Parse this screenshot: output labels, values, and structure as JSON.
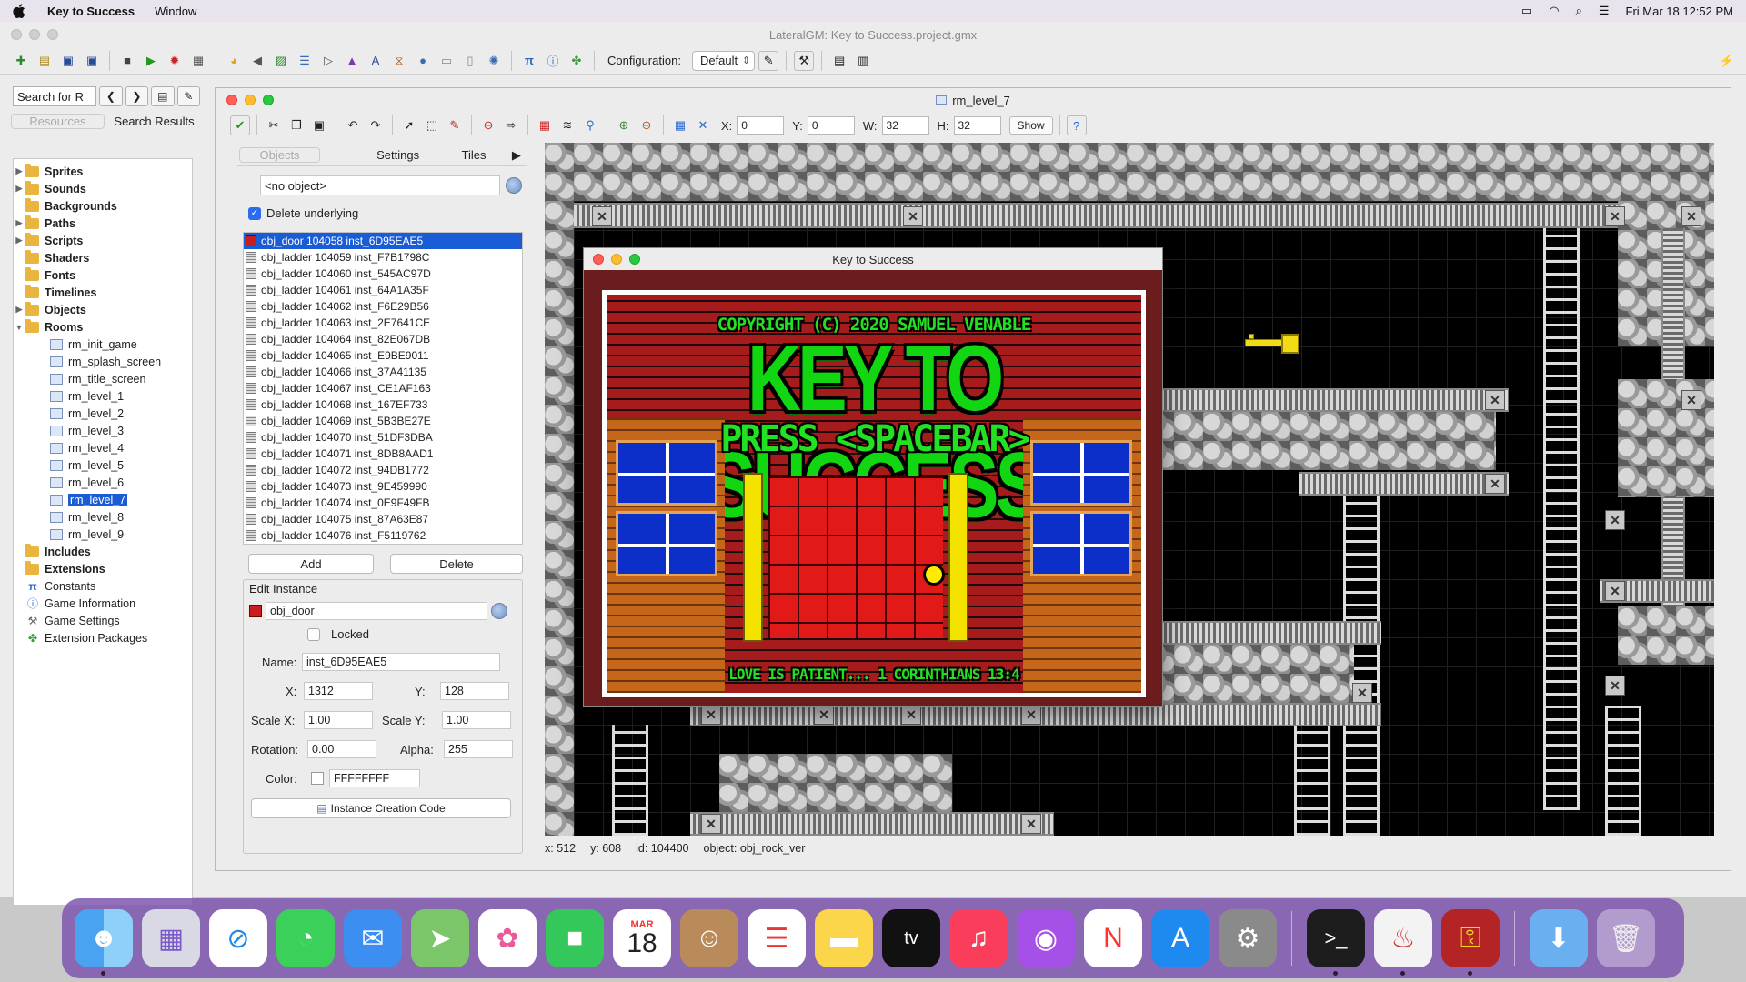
{
  "menubar": {
    "app_name": "Key to Success",
    "menus": [
      "Window"
    ],
    "datetime": "Fri Mar 18  12:52 PM"
  },
  "main_window": {
    "title": "LateralGM: Key to Success.project.gmx",
    "config_label": "Configuration:",
    "config_value": "Default"
  },
  "resource_panel": {
    "search_placeholder": "Search for R",
    "tabs": [
      "Resources",
      "Search Results"
    ],
    "tree": {
      "sprites": "Sprites",
      "sounds": "Sounds",
      "backgrounds": "Backgrounds",
      "paths": "Paths",
      "scripts": "Scripts",
      "shaders": "Shaders",
      "fonts": "Fonts",
      "timelines": "Timelines",
      "objects": "Objects",
      "rooms": "Rooms",
      "room_items": [
        "rm_init_game",
        "rm_splash_screen",
        "rm_title_screen",
        "rm_level_1",
        "rm_level_2",
        "rm_level_3",
        "rm_level_4",
        "rm_level_5",
        "rm_level_6",
        "rm_level_7",
        "rm_level_8",
        "rm_level_9"
      ],
      "includes": "Includes",
      "extensions": "Extensions",
      "constants": "Constants",
      "game_information": "Game Information",
      "game_settings": "Game Settings",
      "extension_packages": "Extension Packages"
    }
  },
  "room_editor": {
    "title": "rm_level_7",
    "coords": {
      "x_label": "X:",
      "x": "0",
      "y_label": "Y:",
      "y": "0",
      "w_label": "W:",
      "w": "32",
      "h_label": "H:",
      "h": "32"
    },
    "show_label": "Show",
    "tabs": [
      "Objects",
      "Settings",
      "Tiles"
    ],
    "object_selector": "<no object>",
    "delete_underlying": "Delete underlying",
    "instances": [
      "obj_door 104058 inst_6D95EAE5",
      "obj_ladder 104059 inst_F7B1798C",
      "obj_ladder 104060 inst_545AC97D",
      "obj_ladder 104061 inst_64A1A35F",
      "obj_ladder 104062 inst_F6E29B56",
      "obj_ladder 104063 inst_2E7641CE",
      "obj_ladder 104064 inst_82E067DB",
      "obj_ladder 104065 inst_E9BE9011",
      "obj_ladder 104066 inst_37A41135",
      "obj_ladder 104067 inst_CE1AF163",
      "obj_ladder 104068 inst_167EF733",
      "obj_ladder 104069 inst_5B3BE27E",
      "obj_ladder 104070 inst_51DF3DBA",
      "obj_ladder 104071 inst_8DB8AAD1",
      "obj_ladder 104072 inst_94DB1772",
      "obj_ladder 104073 inst_9E459990",
      "obj_ladder 104074 inst_0E9F49FB",
      "obj_ladder 104075 inst_87A63E87",
      "obj_ladder 104076 inst_F5119762"
    ],
    "add_label": "Add",
    "delete_label": "Delete",
    "edit_instance": {
      "heading": "Edit Instance",
      "object": "obj_door",
      "locked_label": "Locked",
      "name_label": "Name:",
      "name": "inst_6D95EAE5",
      "x_label": "X:",
      "x": "1312",
      "y_label": "Y:",
      "y": "128",
      "scale_x_label": "Scale X:",
      "scale_x": "1.00",
      "scale_y_label": "Scale Y:",
      "scale_y": "1.00",
      "rotation_label": "Rotation:",
      "rotation": "0.00",
      "alpha_label": "Alpha:",
      "alpha": "255",
      "color_label": "Color:",
      "color": "FFFFFFFF",
      "creation_code_label": "Instance Creation Code"
    },
    "status": {
      "x": "x: 512",
      "y": "y: 608",
      "id": "id: 104400",
      "object": "object: obj_rock_ver"
    }
  },
  "game_window": {
    "title": "Key to Success",
    "copyright": "COPYRIGHT (C) 2020 SAMUEL VENABLE",
    "game_title": "KEY TO SUCCESS",
    "prompt": "PRESS <SPACEBAR>",
    "verse": "LOVE IS PATIENT... 1 CORINTHIANS 13:4"
  },
  "dock": {
    "calendar_month": "MAR",
    "calendar_day": "18",
    "tv_label": "tv"
  },
  "colors": {
    "selection": "#1a5bd6",
    "game_green": "#22e022",
    "door_red": "#e11919",
    "key_yellow": "#f3da17"
  }
}
